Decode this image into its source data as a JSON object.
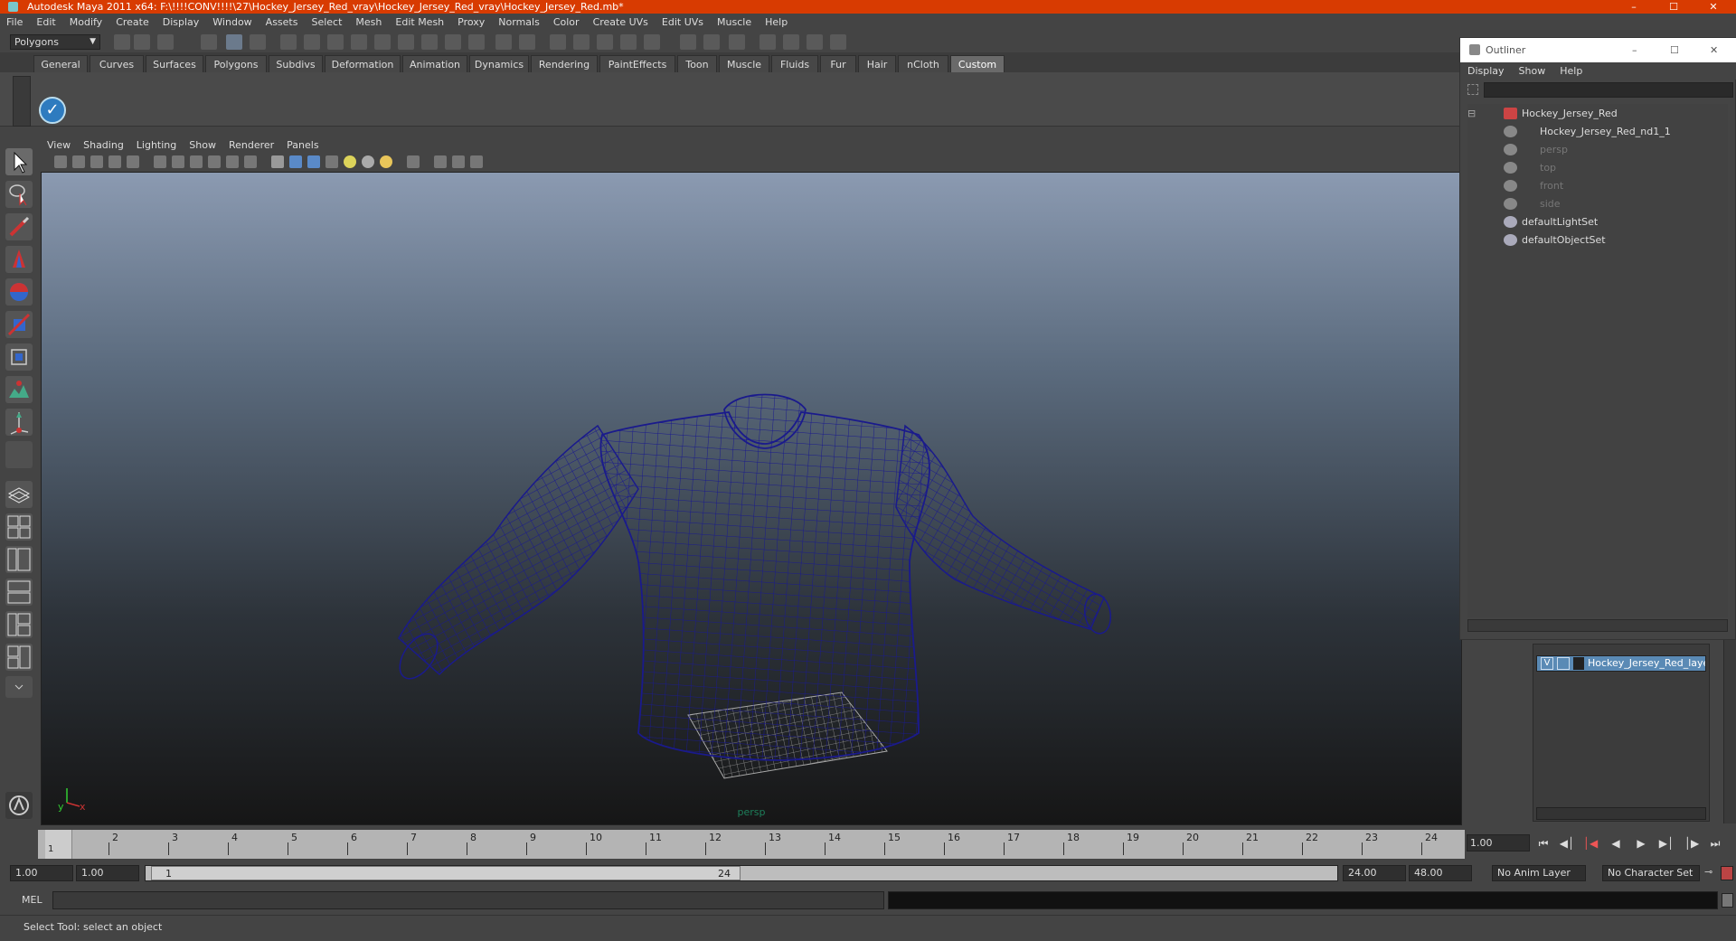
{
  "window": {
    "title": "Autodesk Maya 2011 x64: F:\\!!!!CONV!!!!\\27\\Hockey_Jersey_Red_vray\\Hockey_Jersey_Red_vray\\Hockey_Jersey_Red.mb*"
  },
  "menubar": [
    "File",
    "Edit",
    "Modify",
    "Create",
    "Display",
    "Window",
    "Assets",
    "Select",
    "Mesh",
    "Edit Mesh",
    "Proxy",
    "Normals",
    "Color",
    "Create UVs",
    "Edit UVs",
    "Muscle",
    "Help"
  ],
  "toolbar": {
    "mode": "Polygons"
  },
  "shelf": {
    "tabs": [
      "General",
      "Curves",
      "Surfaces",
      "Polygons",
      "Subdivs",
      "Deformation",
      "Animation",
      "Dynamics",
      "Rendering",
      "PaintEffects",
      "Toon",
      "Muscle",
      "Fluids",
      "Fur",
      "Hair",
      "nCloth",
      "Custom"
    ],
    "active_tab": "Custom"
  },
  "panel": {
    "menu": [
      "View",
      "Shading",
      "Lighting",
      "Show",
      "Renderer",
      "Panels"
    ],
    "camera_label": "persp"
  },
  "timeline": {
    "ticks": [
      "1",
      "2",
      "3",
      "4",
      "5",
      "6",
      "7",
      "8",
      "9",
      "10",
      "11",
      "12",
      "13",
      "14",
      "15",
      "16",
      "17",
      "18",
      "19",
      "20",
      "21",
      "22",
      "23",
      "24"
    ],
    "current_marker": "1",
    "current_frame": "1.00"
  },
  "range": {
    "start": "1.00",
    "playback_start": "1.00",
    "slider_start": "1",
    "slider_end": "24",
    "playback_end": "24.00",
    "end": "48.00",
    "anim_layer": "No Anim Layer",
    "character_set": "No Character Set"
  },
  "command": {
    "label": "MEL"
  },
  "status": {
    "help": "Select Tool: select an object"
  },
  "outliner": {
    "title": "Outliner",
    "menu": [
      "Display",
      "Show",
      "Help"
    ],
    "items": [
      {
        "label": "Hockey_Jersey_Red",
        "dim": false
      },
      {
        "label": "Hockey_Jersey_Red_nd1_1",
        "dim": false
      },
      {
        "label": "persp",
        "dim": true
      },
      {
        "label": "top",
        "dim": true
      },
      {
        "label": "front",
        "dim": true
      },
      {
        "label": "side",
        "dim": true
      },
      {
        "label": "defaultLightSet",
        "dim": false
      },
      {
        "label": "defaultObjectSet",
        "dim": false
      }
    ]
  },
  "layers": {
    "row": {
      "visible": "V",
      "name": "Hockey_Jersey_Red_layer"
    }
  },
  "colors": {
    "titlebar": "#d83b01",
    "wireframe": "#1a1a8c",
    "layer_highlight": "#5a8ab5"
  }
}
